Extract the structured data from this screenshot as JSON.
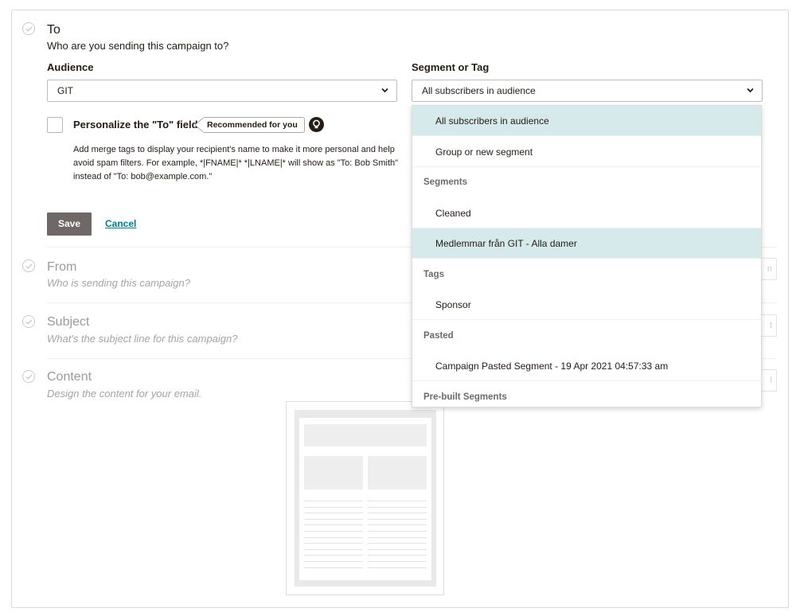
{
  "sections": {
    "to": {
      "title": "To",
      "subtitle": "Who are you sending this campaign to?",
      "audience_label": "Audience",
      "audience_value": "GIT",
      "segment_label": "Segment or Tag",
      "segment_value": "All subscribers in audience",
      "personalize_label": "Personalize the \"To\" field",
      "recommended_badge": "Recommended for you",
      "help_text": "Add merge tags to display your recipient's name to make it more personal and help avoid spam filters. For example, *|FNAME|* *|LNAME|* will show as \"To: Bob Smith\" instead of \"To: bob@example.com.\"",
      "save_label": "Save",
      "cancel_label": "Cancel"
    },
    "from": {
      "title": "From",
      "subtitle": "Who is sending this campaign?",
      "button_fragment": "n"
    },
    "subject": {
      "title": "Subject",
      "subtitle": "What's the subject line for this campaign?",
      "button_fragment": "t"
    },
    "content": {
      "title": "Content",
      "subtitle": "Design the content for your email.",
      "button_fragment": "l"
    }
  },
  "dropdown": {
    "items": [
      {
        "kind": "option",
        "label": "All subscribers in audience",
        "highlighted": true
      },
      {
        "kind": "option",
        "label": "Group or new segment",
        "highlighted": false
      },
      {
        "kind": "group",
        "label": "Segments"
      },
      {
        "kind": "option",
        "label": "Cleaned",
        "highlighted": false
      },
      {
        "kind": "option",
        "label": "Medlemmar från GIT - Alla damer",
        "highlighted": true
      },
      {
        "kind": "group",
        "label": "Tags"
      },
      {
        "kind": "option",
        "label": "Sponsor",
        "highlighted": false
      },
      {
        "kind": "group",
        "label": "Pasted"
      },
      {
        "kind": "option",
        "label": "Campaign Pasted Segment - 19 Apr 2021 04:57:33 am",
        "highlighted": false
      },
      {
        "kind": "group",
        "label": "Pre-built Segments"
      }
    ]
  },
  "colors": {
    "accent_link": "#007c89",
    "highlight_row": "#d6eaec",
    "save_button": "#6e6966"
  },
  "icons": {
    "section_status": "check-circle-icon",
    "select_caret": "chevron-down-icon",
    "badge": "lightbulb-icon"
  }
}
